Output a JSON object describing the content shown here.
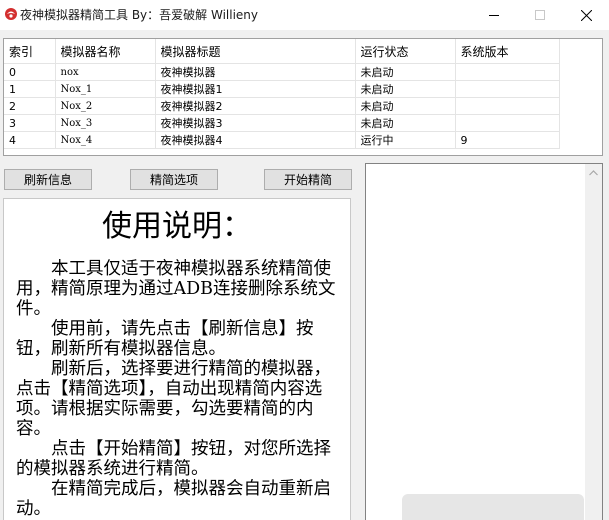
{
  "window": {
    "title": "夜神模拟器精简工具 By：吾爱破解 Willieny"
  },
  "grid": {
    "columns": [
      "索引",
      "模拟器名称",
      "模拟器标题",
      "运行状态",
      "系统版本"
    ],
    "rows": [
      [
        "0",
        "nox",
        "夜神模拟器",
        "未启动",
        ""
      ],
      [
        "1",
        "Nox_1",
        "夜神模拟器1",
        "未启动",
        ""
      ],
      [
        "2",
        "Nox_2",
        "夜神模拟器2",
        "未启动",
        ""
      ],
      [
        "3",
        "Nox_3",
        "夜神模拟器3",
        "未启动",
        ""
      ],
      [
        "4",
        "Nox_4",
        "夜神模拟器4",
        "运行中",
        "9"
      ]
    ]
  },
  "buttons": {
    "refresh": "刷新信息",
    "options": "精简选项",
    "start": "开始精简"
  },
  "instructions": {
    "title": "使用说明：",
    "paragraphs": [
      "本工具仅适于夜神模拟器系统精简使用，精简原理为通过ADB连接删除系统文件。",
      "使用前，请先点击【刷新信息】按钮，刷新所有模拟器信息。",
      "刷新后，选择要进行精简的模拟器，点击【精简选项】，自动出现精简内容选项。请根据实际需要，勾选要精简的内容。",
      "点击【开始精简】按钮，对您所选择的模拟器系统进行精简。",
      "在精简完成后，模拟器会自动重新启动。"
    ]
  },
  "icons": {
    "app": "app-icon",
    "minimize": "minimize-icon",
    "maximize": "maximize-icon",
    "close": "close-icon",
    "scroll_up": "chevron-up-icon"
  }
}
